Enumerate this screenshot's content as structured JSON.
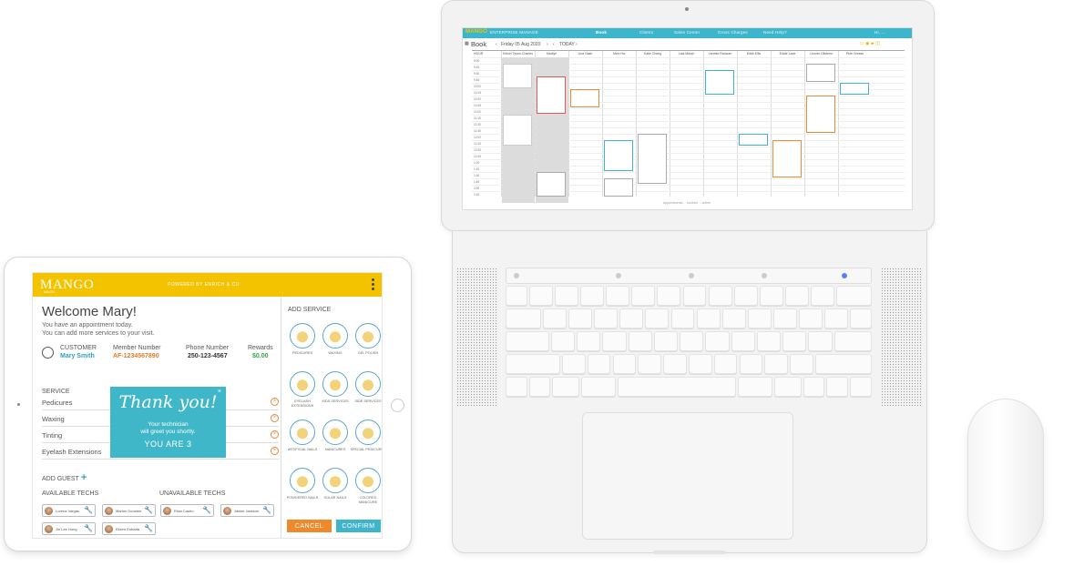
{
  "laptop": {
    "app_logo": "MANGO",
    "app_name": "ENTERPRISE MANAGE",
    "nav": [
      "Book",
      "Clients",
      "Sales Center",
      "Gross Charges",
      "Need Help?"
    ],
    "user": "Hi, ...",
    "book_title": "Book",
    "date_label": "Friday 05 Aug 2020",
    "today_label": "TODAY",
    "time_header": "HOUR",
    "staff": [
      "Kelvin Tyson-Charles",
      "Marilyn",
      "Lina Nash",
      "Minh Ha",
      "Katie Chang",
      "Lisa Marsh",
      "Lenette Ransom",
      "Edith Ellis",
      "Eddie Lane",
      "Lenore Gilsteen",
      "Pete Gresse"
    ],
    "times": [
      "9:00",
      "9:15",
      "9:30",
      "9:45",
      "10:00",
      "10:15",
      "10:30",
      "10:45",
      "11:00",
      "11:15",
      "11:30",
      "11:45",
      "12:00",
      "12:15",
      "12:30",
      "12:45",
      "1:00",
      "1:15",
      "1:30",
      "1:45",
      "2:00",
      "2:15"
    ],
    "footnote": "Appointments ... booked ... online"
  },
  "tablet": {
    "logo": "MANGO",
    "logo_sub": "SALON",
    "powered_by": "POWERED BY ENRICH & CO",
    "welcome": "Welcome Mary!",
    "sub1": "You have an appointment today.",
    "sub2": "You can add more services to your visit.",
    "customer_label": "CUSTOMER",
    "customer_name": "Mary Smith",
    "member_label": "Member Number",
    "member_value": "AF-1234567890",
    "phone_label": "Phone Number",
    "phone_value": "250-123-4567",
    "rewards_label": "Rewards",
    "rewards_value": "$0.00",
    "service_header": "SERVICE",
    "services": [
      "Pedicures",
      "Waxing",
      "Tinting",
      "Eyelash Extensions"
    ],
    "popup": {
      "title": "Thank you!",
      "line1": "Your technician",
      "line2": "will greet you shortly.",
      "queue": "YOU ARE 3",
      "close": "×"
    },
    "add_guest": "ADD GUEST",
    "available_header": "AVAILABLE TECHS",
    "unavailable_header": "UNAVAILABLE TECHS",
    "available": [
      "Lorena Vargas",
      "Marion Donalee",
      "Jin Lee Hong",
      "Eileen Estrada"
    ],
    "unavailable": [
      "Elisa Castro",
      "Jackie Jackson"
    ],
    "add_service_header": "ADD SERVICE",
    "service_icons": [
      "PEDICURES",
      "WAXING",
      "GEL POLISH",
      "EYELASH EXTENSIONS",
      "KIDS SERVICES",
      "SIDE SERVICES",
      "ARTIFICIAL NAILS",
      "MANICURES",
      "SPECIAL PEDICURES",
      "POWDERED NAILS",
      "SOLAR NAILS",
      "COLORED MANICURE"
    ],
    "cancel": "CANCEL",
    "confirm": "CONFIRM"
  },
  "colors": {
    "brand_yellow": "#f4c300",
    "accent_teal": "#3fb4cb",
    "cancel_orange": "#ee8a2c"
  }
}
